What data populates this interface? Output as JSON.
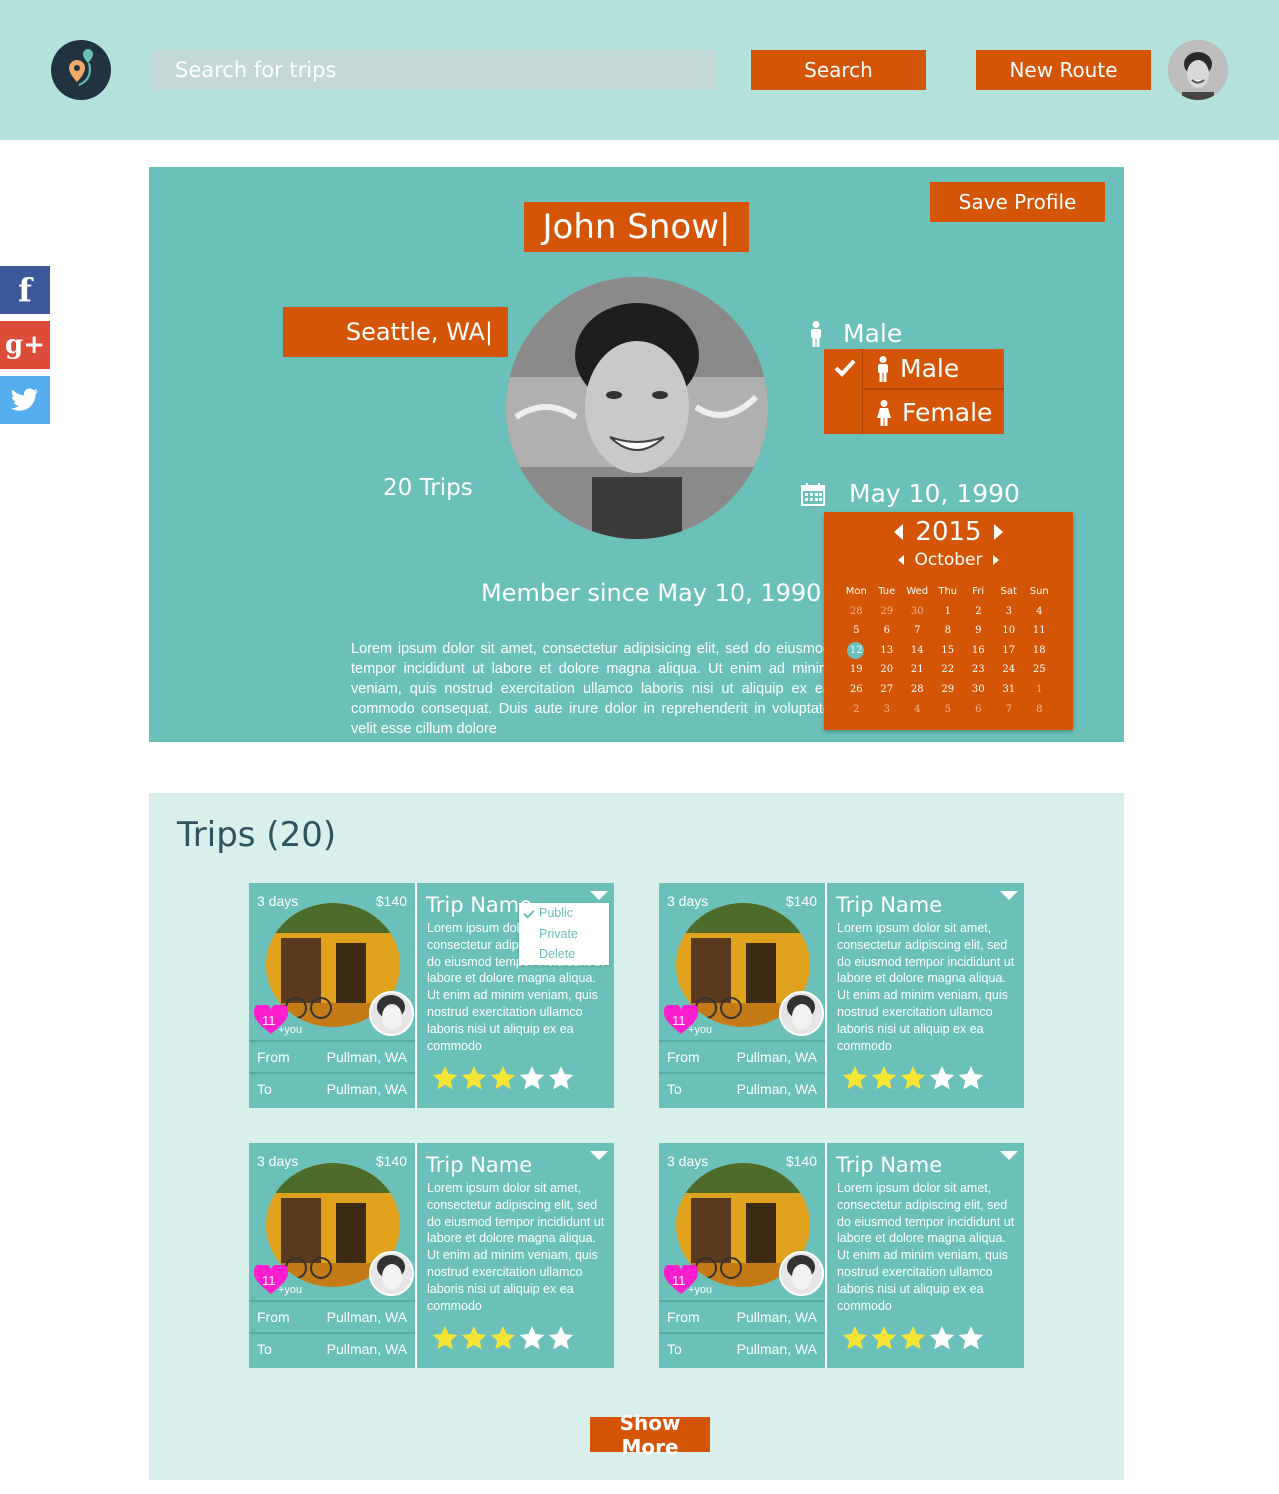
{
  "header": {
    "search_placeholder": "Search for trips",
    "search_button": "Search",
    "new_route_button": "New Route",
    "logo_icon": "map-pin-logo-icon",
    "avatar_icon": "user-avatar"
  },
  "social": {
    "facebook": "f",
    "google_plus": "g+",
    "twitter_icon": "twitter-icon"
  },
  "profile": {
    "save_button": "Save Profile",
    "name": "John Snow|",
    "city": "Seattle, WA|",
    "trips_count": "20 Trips",
    "member_since": "Member since May 10, 1990",
    "bio": "Lorem ipsum dolor sit amet, consectetur adipisicing elit, sed do eiusmod tempor incididunt ut labore et dolore magna aliqua. Ut enim ad minim veniam, quis nostrud exercitation ullamco laboris nisi ut aliquip ex ea commodo consequat. Duis aute irure dolor in reprehenderit in voluptate velit esse cillum dolore",
    "gender": {
      "current": "Male",
      "options": [
        "Male",
        "Female"
      ],
      "selected": "Male"
    },
    "dob": "May 10, 1990",
    "calendar": {
      "year": "2015",
      "month": "October",
      "weekdays": [
        "Mon",
        "Tue",
        "Wed",
        "Thu",
        "Fri",
        "Sat",
        "Sun"
      ],
      "weeks": [
        [
          "28",
          "29",
          "30",
          "1",
          "2",
          "3",
          "4"
        ],
        [
          "5",
          "6",
          "7",
          "8",
          "9",
          "10",
          "11"
        ],
        [
          "12",
          "13",
          "14",
          "15",
          "16",
          "17",
          "18"
        ],
        [
          "19",
          "20",
          "21",
          "22",
          "23",
          "24",
          "25"
        ],
        [
          "26",
          "27",
          "28",
          "29",
          "30",
          "31",
          "1"
        ],
        [
          "2",
          "3",
          "4",
          "5",
          "6",
          "7",
          "8"
        ]
      ],
      "selected_day": "12"
    },
    "colors": {
      "panel": "#6bc1b9",
      "accent": "#d45506"
    }
  },
  "trips": {
    "title": "Trips (20)",
    "show_more": "Show More",
    "dropdown_options": [
      "Public",
      "Private",
      "Delete"
    ],
    "dropdown_checked": "Public",
    "cards": [
      {
        "days": "3 days",
        "price": "$140",
        "name": "Trip Name",
        "description": "Lorem ipsum dolor sit amet, consectetur adipiscing elit, sed do eiusmod tempor incididunt ut labore et dolore magna aliqua. Ut enim ad minim veniam, quis nostrud exercitation ullamco laboris nisi ut aliquip ex ea commodo",
        "likes": "11",
        "likes_suffix": "+you",
        "from_label": "From",
        "from": "Pullman, WA",
        "to_label": "To",
        "to": "Pullman, WA",
        "rating": 3,
        "max_rating": 5
      },
      {
        "days": "3 days",
        "price": "$140",
        "name": "Trip Name",
        "description": "Lorem ipsum dolor sit amet, consectetur adipiscing elit, sed do eiusmod tempor incididunt ut labore et dolore magna aliqua. Ut enim ad minim veniam, quis nostrud exercitation ullamco laboris nisi ut aliquip ex ea commodo",
        "likes": "11",
        "likes_suffix": "+you",
        "from_label": "From",
        "from": "Pullman, WA",
        "to_label": "To",
        "to": "Pullman, WA",
        "rating": 3,
        "max_rating": 5
      },
      {
        "days": "3 days",
        "price": "$140",
        "name": "Trip Name",
        "description": "Lorem ipsum dolor sit amet, consectetur adipiscing elit, sed do eiusmod tempor incididunt ut labore et dolore magna aliqua. Ut enim ad minim veniam, quis nostrud exercitation ullamco laboris nisi ut aliquip ex ea commodo",
        "likes": "11",
        "likes_suffix": "+you",
        "from_label": "From",
        "from": "Pullman, WA",
        "to_label": "To",
        "to": "Pullman, WA",
        "rating": 3,
        "max_rating": 5
      },
      {
        "days": "3 days",
        "price": "$140",
        "name": "Trip Name",
        "description": "Lorem ipsum dolor sit amet, consectetur adipiscing elit, sed do eiusmod tempor incididunt ut labore et dolore magna aliqua. Ut enim ad minim veniam, quis nostrud exercitation ullamco laboris nisi ut aliquip ex ea commodo",
        "likes": "11",
        "likes_suffix": "+you",
        "from_label": "From",
        "from": "Pullman, WA",
        "to_label": "To",
        "to": "Pullman, WA",
        "rating": 3,
        "max_rating": 5
      }
    ]
  }
}
